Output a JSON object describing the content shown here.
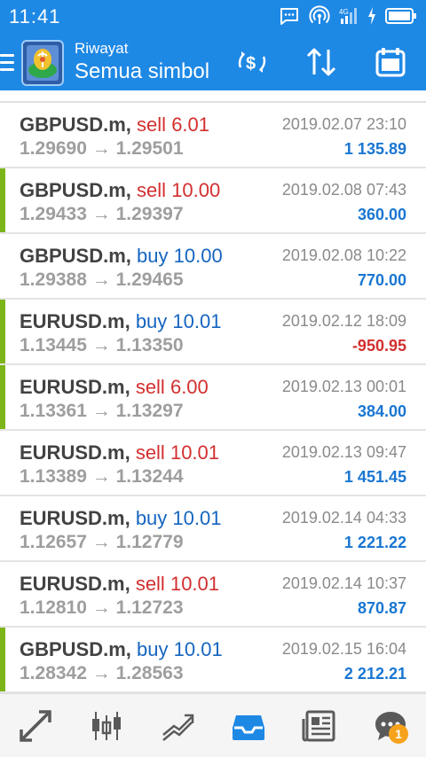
{
  "status_bar": {
    "time": "11:41",
    "icons": [
      "chat-notification-icon",
      "hotspot-icon",
      "signal-icon",
      "charging-icon",
      "battery-icon"
    ]
  },
  "app_bar": {
    "subtitle": "Riwayat",
    "title": "Semua simbol",
    "actions": [
      "exchange-icon",
      "sort-icon",
      "calendar-icon"
    ]
  },
  "trades": [
    {
      "symbol": "GBPUSD.m,",
      "direction": "sell",
      "volume": "6.01",
      "open": "1.29690",
      "close": "1.29501",
      "time": "2019.02.07 23:10",
      "profit": "1 135.89",
      "profit_sign": "pos",
      "marked": false
    },
    {
      "symbol": "GBPUSD.m,",
      "direction": "sell",
      "volume": "10.00",
      "open": "1.29433",
      "close": "1.29397",
      "time": "2019.02.08 07:43",
      "profit": "360.00",
      "profit_sign": "pos",
      "marked": true
    },
    {
      "symbol": "GBPUSD.m,",
      "direction": "buy",
      "volume": "10.00",
      "open": "1.29388",
      "close": "1.29465",
      "time": "2019.02.08 10:22",
      "profit": "770.00",
      "profit_sign": "pos",
      "marked": false
    },
    {
      "symbol": "EURUSD.m,",
      "direction": "buy",
      "volume": "10.01",
      "open": "1.13445",
      "close": "1.13350",
      "time": "2019.02.12 18:09",
      "profit": "-950.95",
      "profit_sign": "neg",
      "marked": true
    },
    {
      "symbol": "EURUSD.m,",
      "direction": "sell",
      "volume": "6.00",
      "open": "1.13361",
      "close": "1.13297",
      "time": "2019.02.13 00:01",
      "profit": "384.00",
      "profit_sign": "pos",
      "marked": true
    },
    {
      "symbol": "EURUSD.m,",
      "direction": "sell",
      "volume": "10.01",
      "open": "1.13389",
      "close": "1.13244",
      "time": "2019.02.13 09:47",
      "profit": "1 451.45",
      "profit_sign": "pos",
      "marked": false
    },
    {
      "symbol": "EURUSD.m,",
      "direction": "buy",
      "volume": "10.01",
      "open": "1.12657",
      "close": "1.12779",
      "time": "2019.02.14 04:33",
      "profit": "1 221.22",
      "profit_sign": "pos",
      "marked": false
    },
    {
      "symbol": "EURUSD.m,",
      "direction": "sell",
      "volume": "10.01",
      "open": "1.12810",
      "close": "1.12723",
      "time": "2019.02.14 10:37",
      "profit": "870.87",
      "profit_sign": "pos",
      "marked": false
    },
    {
      "symbol": "GBPUSD.m,",
      "direction": "buy",
      "volume": "10.01",
      "open": "1.28342",
      "close": "1.28563",
      "time": "2019.02.15 16:04",
      "profit": "2 212.21",
      "profit_sign": "pos",
      "marked": true
    }
  ],
  "price_arrow": "→",
  "bottom_nav": {
    "tabs": [
      "quotes-icon",
      "chart-candles-icon",
      "trade-icon",
      "history-icon",
      "news-icon",
      "chat-icon"
    ],
    "active": "history-icon",
    "chat_badge": "1"
  },
  "colors": {
    "primary": "#1e88e5",
    "sell": "#d32f2f",
    "buy": "#1565c0",
    "profit_positive": "#1976d2",
    "profit_negative": "#d32f2f",
    "marker": "#7cb518",
    "badge": "#f7a21b"
  }
}
